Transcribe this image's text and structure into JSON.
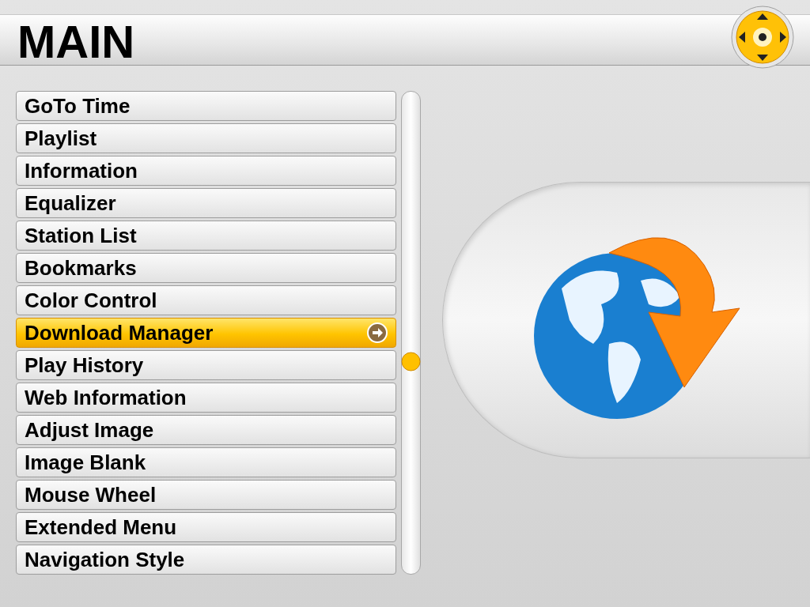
{
  "header": {
    "title": "MAIN"
  },
  "menu": [
    {
      "label": "GoTo Time",
      "selected": false
    },
    {
      "label": "Playlist",
      "selected": false
    },
    {
      "label": "Information",
      "selected": false
    },
    {
      "label": "Equalizer",
      "selected": false
    },
    {
      "label": "Station List",
      "selected": false
    },
    {
      "label": "Bookmarks",
      "selected": false
    },
    {
      "label": "Color Control",
      "selected": false
    },
    {
      "label": "Download Manager",
      "selected": true
    },
    {
      "label": "Play History",
      "selected": false
    },
    {
      "label": "Web Information",
      "selected": false
    },
    {
      "label": "Adjust Image",
      "selected": false
    },
    {
      "label": "Image Blank",
      "selected": false
    },
    {
      "label": "Mouse Wheel",
      "selected": false
    },
    {
      "label": "Extended Menu",
      "selected": false
    },
    {
      "label": "Navigation Style",
      "selected": false
    }
  ]
}
